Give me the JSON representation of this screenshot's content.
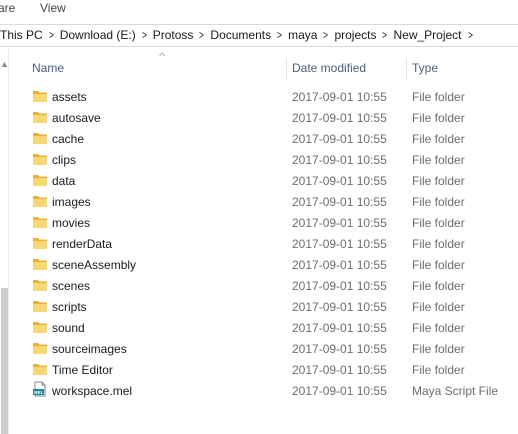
{
  "ribbon": {
    "tabs": [
      "are",
      "View"
    ]
  },
  "address_bar": {
    "crumbs": [
      "This PC",
      "Download (E:)",
      "Protoss",
      "Documents",
      "maya",
      "projects",
      "New_Project"
    ],
    "separator_icon": "chevron-right-icon"
  },
  "columns": {
    "name": "Name",
    "date": "Date modified",
    "type": "Type",
    "sort_icon": "sort-up-icon"
  },
  "items": [
    {
      "name": "assets",
      "date": "2017-09-01 10:55",
      "type": "File folder",
      "icon": "folder-icon"
    },
    {
      "name": "autosave",
      "date": "2017-09-01 10:55",
      "type": "File folder",
      "icon": "folder-icon"
    },
    {
      "name": "cache",
      "date": "2017-09-01 10:55",
      "type": "File folder",
      "icon": "folder-icon"
    },
    {
      "name": "clips",
      "date": "2017-09-01 10:55",
      "type": "File folder",
      "icon": "folder-icon"
    },
    {
      "name": "data",
      "date": "2017-09-01 10:55",
      "type": "File folder",
      "icon": "folder-icon"
    },
    {
      "name": "images",
      "date": "2017-09-01 10:55",
      "type": "File folder",
      "icon": "folder-icon"
    },
    {
      "name": "movies",
      "date": "2017-09-01 10:55",
      "type": "File folder",
      "icon": "folder-icon"
    },
    {
      "name": "renderData",
      "date": "2017-09-01 10:55",
      "type": "File folder",
      "icon": "folder-icon"
    },
    {
      "name": "sceneAssembly",
      "date": "2017-09-01 10:55",
      "type": "File folder",
      "icon": "folder-icon"
    },
    {
      "name": "scenes",
      "date": "2017-09-01 10:55",
      "type": "File folder",
      "icon": "folder-icon"
    },
    {
      "name": "scripts",
      "date": "2017-09-01 10:55",
      "type": "File folder",
      "icon": "folder-icon"
    },
    {
      "name": "sound",
      "date": "2017-09-01 10:55",
      "type": "File folder",
      "icon": "folder-icon"
    },
    {
      "name": "sourceimages",
      "date": "2017-09-01 10:55",
      "type": "File folder",
      "icon": "folder-icon"
    },
    {
      "name": "Time Editor",
      "date": "2017-09-01 10:55",
      "type": "File folder",
      "icon": "folder-icon"
    },
    {
      "name": "workspace.mel",
      "date": "2017-09-01 10:55",
      "type": "Maya Script File",
      "icon": "mel-file-icon"
    }
  ],
  "colors": {
    "folder": "#f8d775",
    "folder_dark": "#e8b23a",
    "header_text": "#4c607a",
    "meta_text": "#6d6d6d"
  }
}
